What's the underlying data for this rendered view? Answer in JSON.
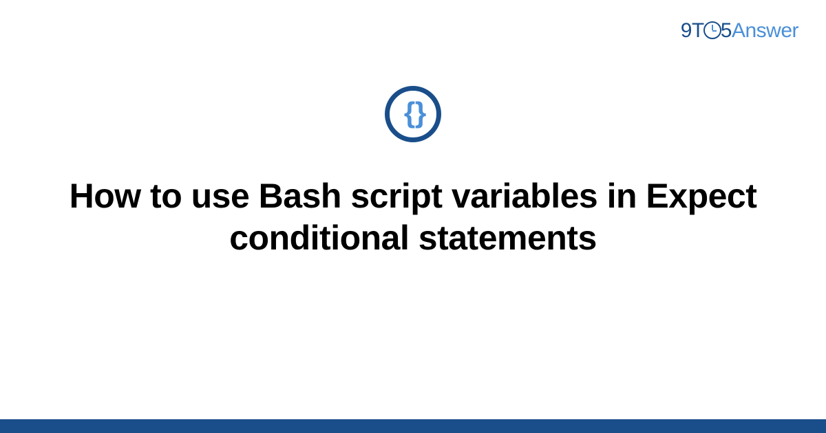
{
  "logo": {
    "part1": "9T",
    "part2": "5",
    "part3": "Answer"
  },
  "icon": {
    "braces": "{ }"
  },
  "title": "How to use Bash script variables in Expect conditional statements"
}
